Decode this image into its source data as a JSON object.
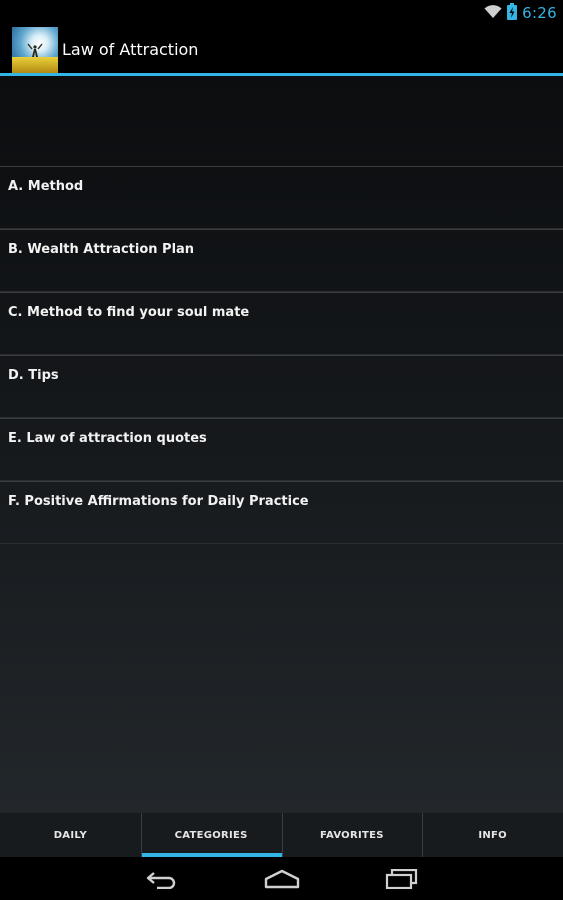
{
  "status_bar": {
    "time": "6:26",
    "icons": [
      "wifi-icon",
      "battery-charging-icon"
    ],
    "accent_color": "#33b5e5"
  },
  "app_bar": {
    "title": "Law of Attraction",
    "icon": "app-logo-icon"
  },
  "categories": [
    {
      "label": "A. Method"
    },
    {
      "label": "B. Wealth Attraction Plan"
    },
    {
      "label": "C. Method to find your soul mate"
    },
    {
      "label": "D. Tips"
    },
    {
      "label": "E. Law of attraction quotes"
    },
    {
      "label": "F. Positive Affirmations for Daily Practice"
    }
  ],
  "tabs": [
    {
      "label": "DAILY",
      "active": false
    },
    {
      "label": "CATEGORIES",
      "active": true
    },
    {
      "label": "FAVORITES",
      "active": false
    },
    {
      "label": "INFO",
      "active": false
    }
  ],
  "nav_bar": {
    "buttons": [
      "back-icon",
      "home-icon",
      "recent-apps-icon"
    ]
  }
}
